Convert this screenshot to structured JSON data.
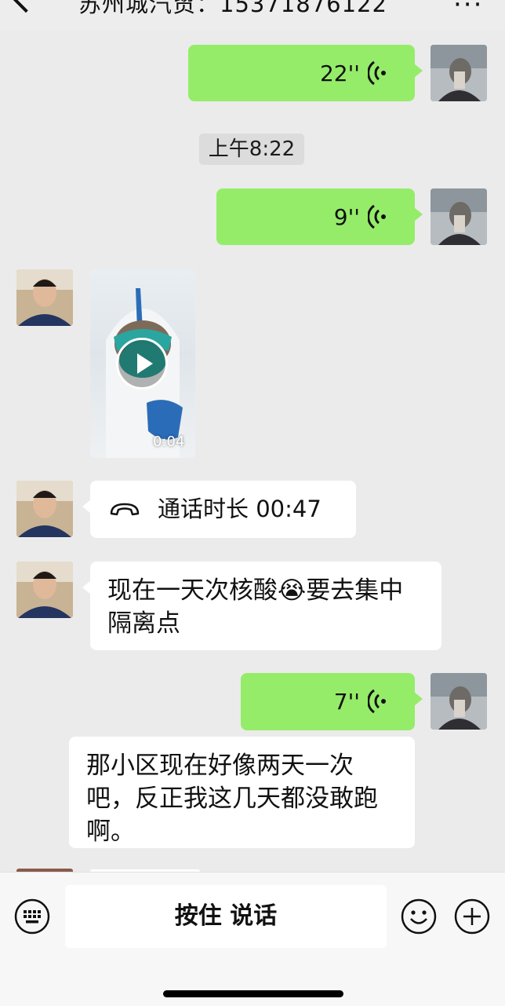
{
  "header": {
    "title": "苏州城汽贸：15371876122"
  },
  "messages": {
    "voice1": {
      "duration": "22''"
    },
    "timestamp": "上午8:22",
    "voice2": {
      "duration": "9''"
    },
    "video": {
      "duration": "0:04"
    },
    "call": {
      "text": "通话时长 00:47"
    },
    "text1": {
      "text": "现在一天次核酸😭要去集中\n隔离点"
    },
    "voice3": {
      "duration": "7''"
    },
    "text2": {
      "text": "那小区现在好像两天一次\n吧，反正我这几天都没敢跑\n啊。"
    }
  },
  "input_bar": {
    "hold_to_talk": "按住 说话"
  },
  "colors": {
    "background": "#ebebeb",
    "sent_bubble": "#95ec69",
    "received_bubble": "#ffffff"
  },
  "icons": [
    "back-arrow-icon",
    "more-icon",
    "voice-wave-icon",
    "play-icon",
    "phone-icon",
    "keyboard-icon",
    "emoji-icon",
    "plus-icon"
  ]
}
